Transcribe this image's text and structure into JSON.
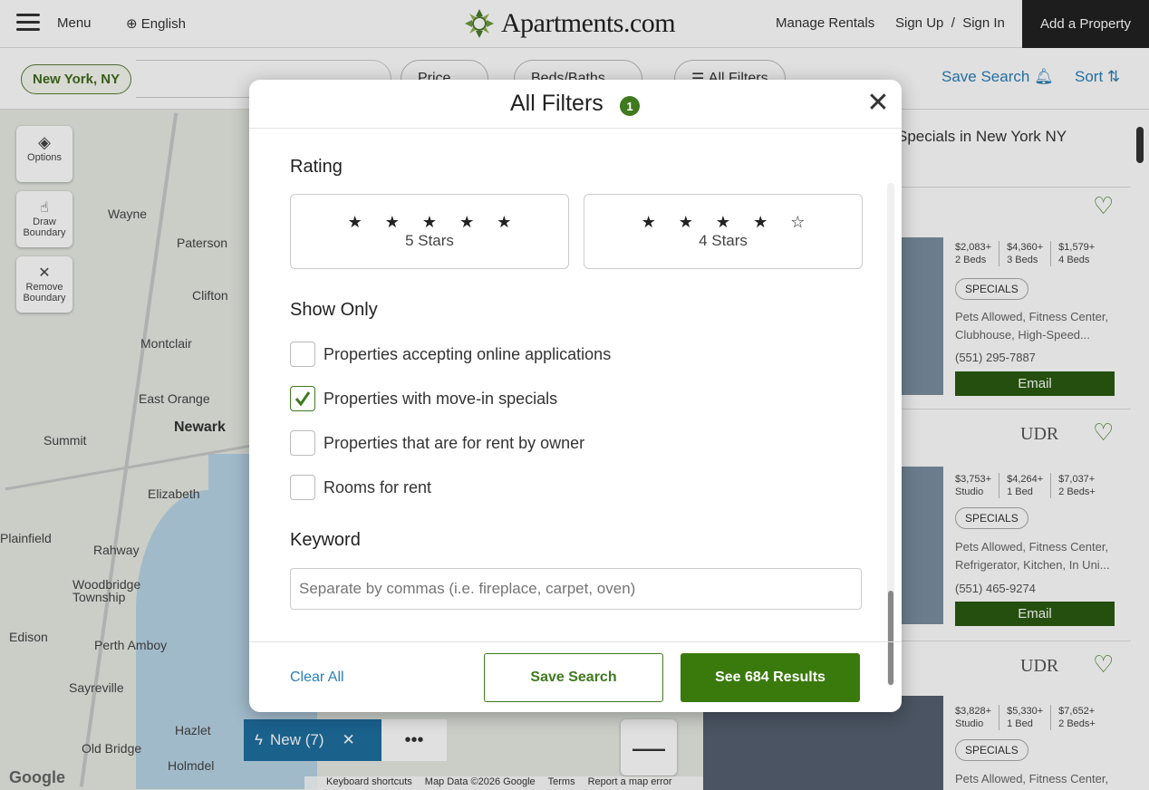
{
  "header": {
    "menu_label": "Menu",
    "language": "English",
    "logo_text": "Apartments.com",
    "manage_rentals": "Manage Rentals",
    "sign_up_in": "Sign Up  /  Sign In",
    "add_property": "Add a Property"
  },
  "search": {
    "location": "New York, NY",
    "price_label": "Price",
    "beds_label": "Beds/Baths",
    "all_filters_label": "All Filters",
    "filter_count": "1",
    "save_search": "Save Search",
    "sort": "Sort"
  },
  "map": {
    "controls": [
      "Options",
      "Draw Boundary",
      "Remove Boundary"
    ],
    "cities": [
      "Wayne",
      "Paterson",
      "Clifton",
      "Montclair",
      "East Orange",
      "Newark",
      "Summit",
      "Elizabeth",
      "Rahway",
      "Woodbridge Township",
      "Perth Amboy",
      "Sayreville",
      "Edison",
      "Hazlet",
      "Old Bridge",
      "Holmdel",
      "Plainfield"
    ],
    "new_label": "New (7)",
    "footer": [
      "Keyboard shortcuts",
      "Map Data ©2026 Google",
      "Terms",
      "Report a map error"
    ],
    "google": "Google"
  },
  "listings": {
    "heading": "Specials in New York NY",
    "cards": [
      {
        "prices": [
          [
            "$2,083+",
            "2 Beds"
          ],
          [
            "$4,360+",
            "3 Beds"
          ],
          [
            "$1,579+",
            "4 Beds"
          ]
        ],
        "special": "SPECIALS",
        "amenities": "Pets Allowed, Fitness Center, Clubhouse, High-Speed...",
        "phone": "(551) 295-7887",
        "email": "Email"
      },
      {
        "brand": "UDR",
        "prices": [
          [
            "$3,753+",
            "Studio"
          ],
          [
            "$4,264+",
            "1 Bed"
          ],
          [
            "$7,037+",
            "2 Beds+"
          ]
        ],
        "special": "SPECIALS",
        "amenities": "Pets Allowed, Fitness Center, Refrigerator, Kitchen, In Uni...",
        "phone": "(551) 465-9274",
        "email": "Email"
      },
      {
        "brand": "UDR",
        "prices": [
          [
            "$3,828+",
            "Studio"
          ],
          [
            "$5,330+",
            "1 Bed"
          ],
          [
            "$7,652+",
            "2 Beds+"
          ]
        ],
        "special": "SPECIALS",
        "amenities": "Pets Allowed, Fitness Center,"
      }
    ]
  },
  "modal": {
    "title": "All Filters",
    "badge": "1",
    "rating_title": "Rating",
    "ratings": [
      {
        "stars": "★ ★ ★ ★ ★",
        "label": "5 Stars",
        "value": 5
      },
      {
        "stars": "★ ★ ★ ★ ☆",
        "label": "4 Stars",
        "value": 4
      }
    ],
    "show_only_title": "Show Only",
    "show_only": [
      {
        "label": "Properties accepting online applications",
        "checked": false
      },
      {
        "label": "Properties with move-in specials",
        "checked": true
      },
      {
        "label": "Properties that are for rent by owner",
        "checked": false
      },
      {
        "label": "Rooms for rent",
        "checked": false
      }
    ],
    "keyword_title": "Keyword",
    "keyword_placeholder": "Separate by commas (i.e. fireplace, carpet, oven)",
    "clear_all": "Clear All",
    "save_search": "Save Search",
    "see_results": "See 684 Results"
  },
  "colors": {
    "brand_green": "#3a7a0c",
    "link_blue": "#2a7fb8"
  }
}
